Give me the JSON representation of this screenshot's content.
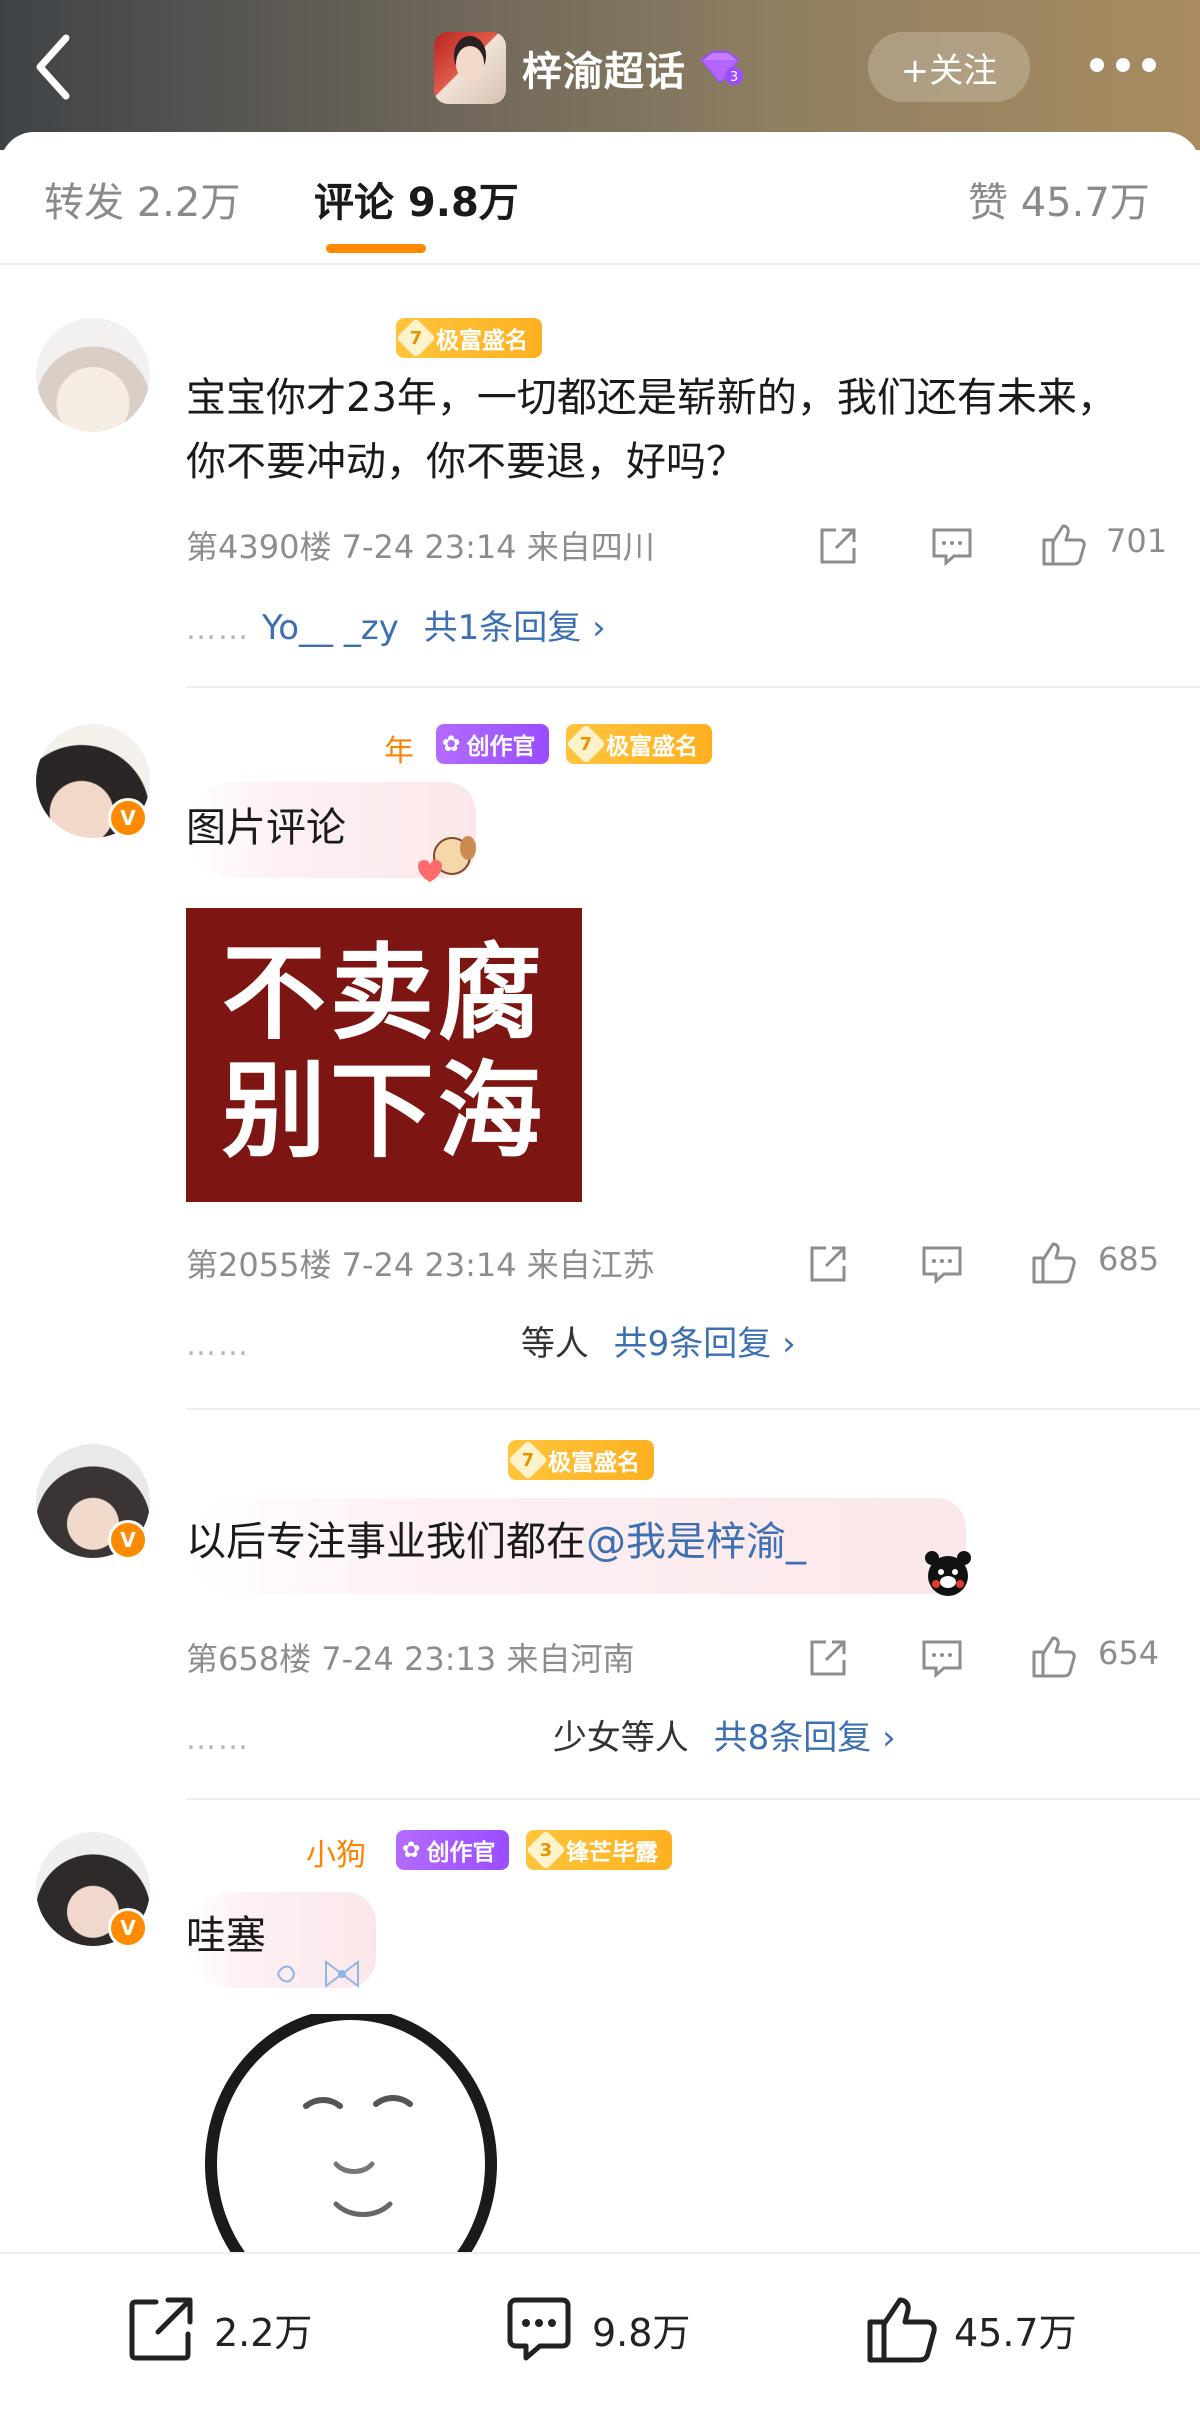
{
  "header": {
    "back_icon": "chevron-left-icon",
    "title": "梓渝超话",
    "level": "3",
    "follow_label": "+关注",
    "more_icon": "more-dots-icon"
  },
  "tabs": {
    "repost": "转发 2.2万",
    "comments": "评论 9.8万",
    "likes": "赞 45.7万",
    "active_color": "#ff8a00"
  },
  "comments": [
    {
      "username_visible": "",
      "badges": [
        {
          "level": "7",
          "label": "极富盛名"
        }
      ],
      "text": "宝宝你才23年，一切都还是崭新的，我们还有未来，你不要冲动，你不要退，好吗？",
      "meta": "第4390楼  7-24 23:14  来自四川",
      "likes": "701",
      "replies_prefix": "Yo__ _zy",
      "replies_label": "共1条回复",
      "chevron": "›"
    },
    {
      "username_visible": "年",
      "badges": [
        {
          "label": "创作官"
        },
        {
          "level": "7",
          "label": "极富盛名"
        }
      ],
      "text": "图片评论",
      "image_text_line1": "不卖腐",
      "image_text_line2": "别下海",
      "meta": "第2055楼  7-24 23:14  来自江苏",
      "likes": "685",
      "replies_prefix": "等人",
      "replies_label": "共9条回复",
      "chevron": "›"
    },
    {
      "username_visible": "",
      "badges": [
        {
          "level": "7",
          "label": "极富盛名"
        }
      ],
      "text_prefix": "以后专注事业我们都在",
      "mention": "@我是梓渝_",
      "meta": "第658楼  7-24 23:13  来自河南",
      "likes": "654",
      "replies_prefix": "少女等人",
      "replies_label": "共8条回复",
      "chevron": "›"
    },
    {
      "username_visible": "小狗",
      "badges": [
        {
          "label": "创作官"
        },
        {
          "level": "3",
          "label": "锋芒毕露"
        }
      ],
      "text": "哇塞",
      "meta": "",
      "likes": ""
    }
  ],
  "bottombar": {
    "repost_count": "2.2万",
    "comment_count": "9.8万",
    "like_count": "45.7万"
  },
  "replies_dots": "……"
}
